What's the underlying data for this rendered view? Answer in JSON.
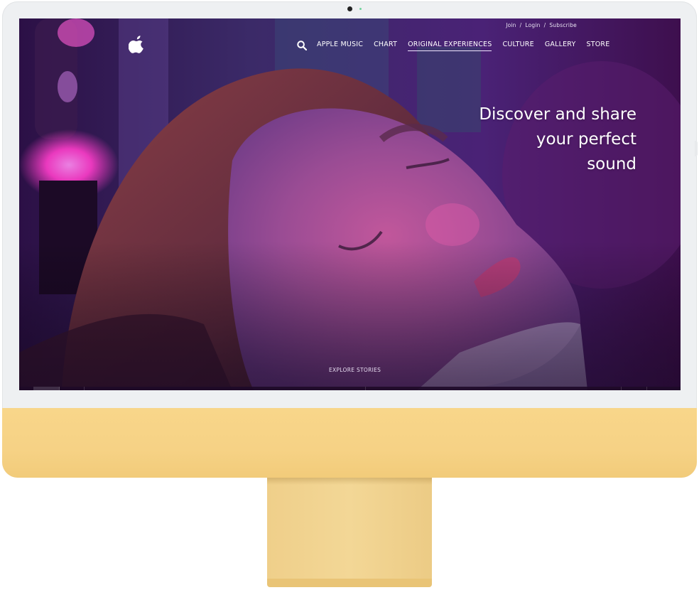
{
  "header": {
    "account_links": {
      "join": "Join",
      "separator": "/",
      "login": "Login",
      "subscribe": "Subscribe"
    },
    "nav": [
      {
        "label": "APPLE MUSIC",
        "active": false
      },
      {
        "label": "CHART",
        "active": false
      },
      {
        "label": "ORIGINAL EXPERIENCES",
        "active": true
      },
      {
        "label": "CULTURE",
        "active": false
      },
      {
        "label": "GALLERY",
        "active": false
      },
      {
        "label": "STORE",
        "active": false
      }
    ],
    "icons": {
      "logo": "apple-logo",
      "search": "search-icon"
    }
  },
  "hero": {
    "headline_lines": [
      "Discover and share",
      "your perfect",
      "sound"
    ],
    "cta": "EXPLORE STORIES"
  },
  "device": {
    "model": "iMac",
    "colors": {
      "chin": "#f6d285",
      "stand": "#f1d28f",
      "bezel": "#eef0f2"
    }
  }
}
